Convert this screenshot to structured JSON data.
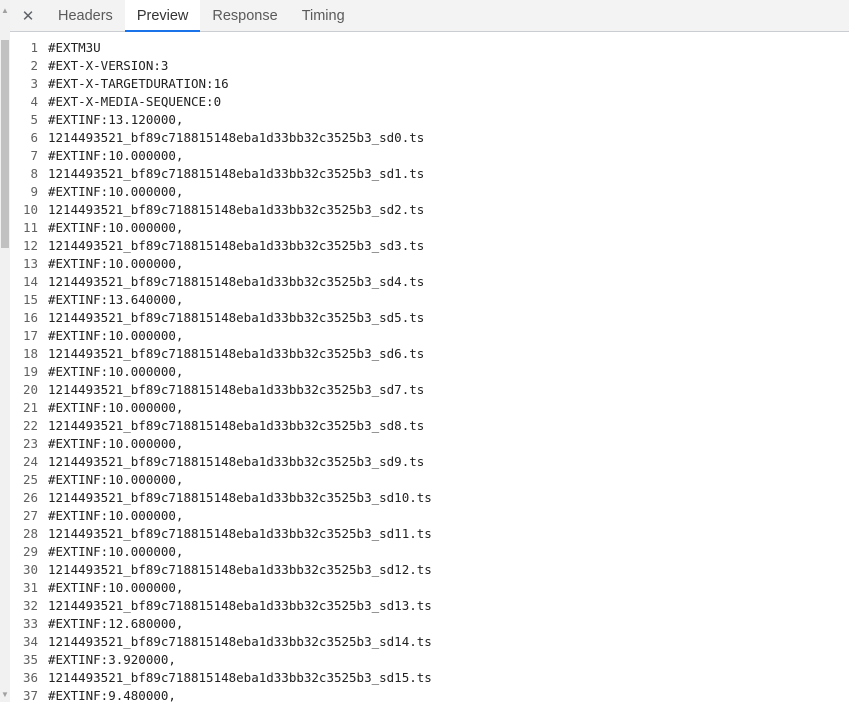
{
  "tabs": {
    "close_label": "✕",
    "items": [
      {
        "label": "Headers",
        "active": false
      },
      {
        "label": "Preview",
        "active": true
      },
      {
        "label": "Response",
        "active": false
      },
      {
        "label": "Timing",
        "active": false
      }
    ]
  },
  "accent_color": "#1a73e8",
  "preview": {
    "lines": [
      {
        "n": "1",
        "text": "#EXTM3U"
      },
      {
        "n": "2",
        "text": "#EXT-X-VERSION:3"
      },
      {
        "n": "3",
        "text": "#EXT-X-TARGETDURATION:16"
      },
      {
        "n": "4",
        "text": "#EXT-X-MEDIA-SEQUENCE:0"
      },
      {
        "n": "5",
        "text": "#EXTINF:13.120000,"
      },
      {
        "n": "6",
        "text": "1214493521_bf89c718815148eba1d33bb32c3525b3_sd0.ts"
      },
      {
        "n": "7",
        "text": "#EXTINF:10.000000,"
      },
      {
        "n": "8",
        "text": "1214493521_bf89c718815148eba1d33bb32c3525b3_sd1.ts"
      },
      {
        "n": "9",
        "text": "#EXTINF:10.000000,"
      },
      {
        "n": "10",
        "text": "1214493521_bf89c718815148eba1d33bb32c3525b3_sd2.ts"
      },
      {
        "n": "11",
        "text": "#EXTINF:10.000000,"
      },
      {
        "n": "12",
        "text": "1214493521_bf89c718815148eba1d33bb32c3525b3_sd3.ts"
      },
      {
        "n": "13",
        "text": "#EXTINF:10.000000,"
      },
      {
        "n": "14",
        "text": "1214493521_bf89c718815148eba1d33bb32c3525b3_sd4.ts"
      },
      {
        "n": "15",
        "text": "#EXTINF:13.640000,"
      },
      {
        "n": "16",
        "text": "1214493521_bf89c718815148eba1d33bb32c3525b3_sd5.ts"
      },
      {
        "n": "17",
        "text": "#EXTINF:10.000000,"
      },
      {
        "n": "18",
        "text": "1214493521_bf89c718815148eba1d33bb32c3525b3_sd6.ts"
      },
      {
        "n": "19",
        "text": "#EXTINF:10.000000,"
      },
      {
        "n": "20",
        "text": "1214493521_bf89c718815148eba1d33bb32c3525b3_sd7.ts"
      },
      {
        "n": "21",
        "text": "#EXTINF:10.000000,"
      },
      {
        "n": "22",
        "text": "1214493521_bf89c718815148eba1d33bb32c3525b3_sd8.ts"
      },
      {
        "n": "23",
        "text": "#EXTINF:10.000000,"
      },
      {
        "n": "24",
        "text": "1214493521_bf89c718815148eba1d33bb32c3525b3_sd9.ts"
      },
      {
        "n": "25",
        "text": "#EXTINF:10.000000,"
      },
      {
        "n": "26",
        "text": "1214493521_bf89c718815148eba1d33bb32c3525b3_sd10.ts"
      },
      {
        "n": "27",
        "text": "#EXTINF:10.000000,"
      },
      {
        "n": "28",
        "text": "1214493521_bf89c718815148eba1d33bb32c3525b3_sd11.ts"
      },
      {
        "n": "29",
        "text": "#EXTINF:10.000000,"
      },
      {
        "n": "30",
        "text": "1214493521_bf89c718815148eba1d33bb32c3525b3_sd12.ts"
      },
      {
        "n": "31",
        "text": "#EXTINF:10.000000,"
      },
      {
        "n": "32",
        "text": "1214493521_bf89c718815148eba1d33bb32c3525b3_sd13.ts"
      },
      {
        "n": "33",
        "text": "#EXTINF:12.680000,"
      },
      {
        "n": "34",
        "text": "1214493521_bf89c718815148eba1d33bb32c3525b3_sd14.ts"
      },
      {
        "n": "35",
        "text": "#EXTINF:3.920000,"
      },
      {
        "n": "36",
        "text": "1214493521_bf89c718815148eba1d33bb32c3525b3_sd15.ts"
      },
      {
        "n": "37",
        "text": "#EXTINF:9.480000,"
      }
    ]
  }
}
